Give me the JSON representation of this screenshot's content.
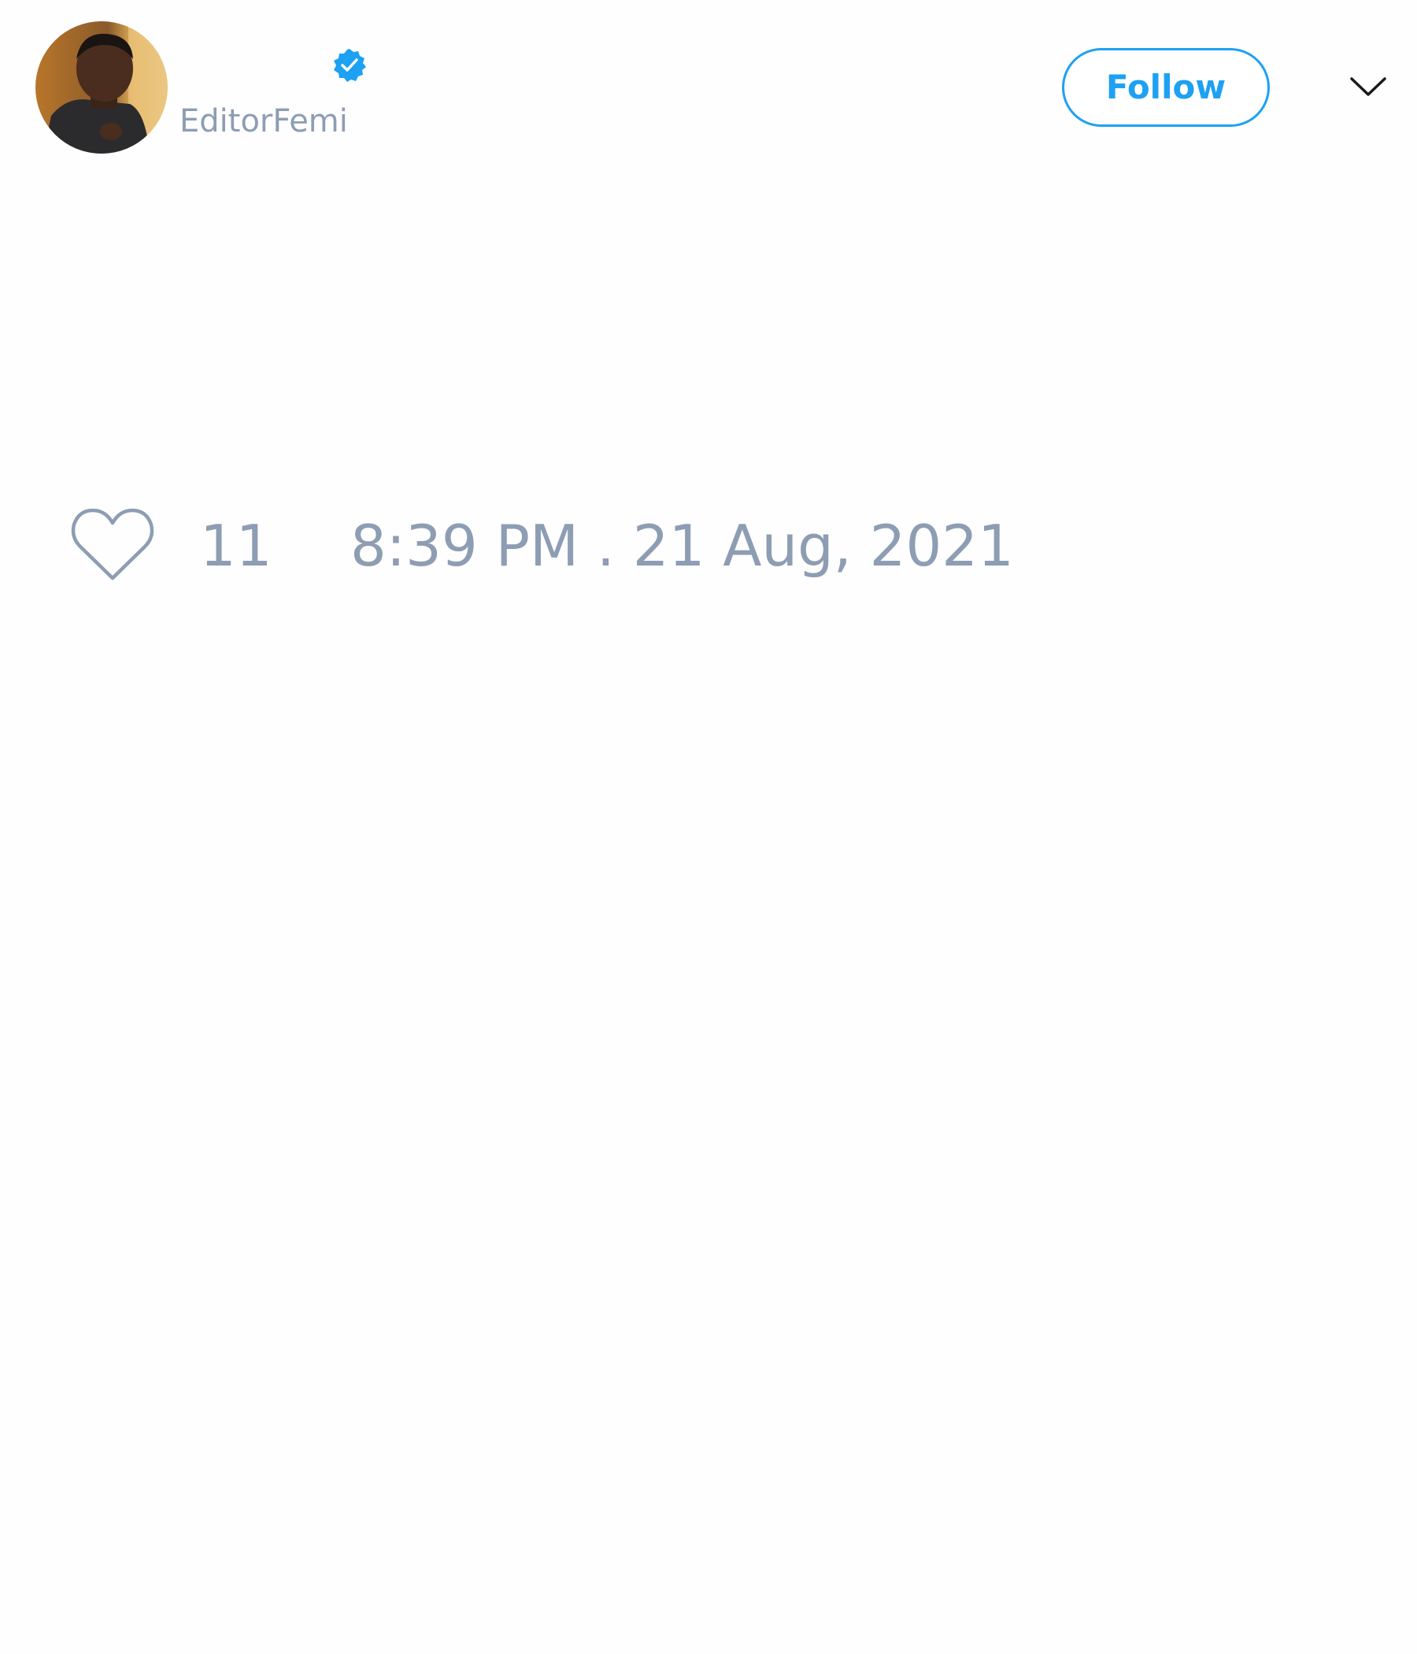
{
  "tweet": {
    "author": {
      "handle": "EditorFemi",
      "avatar_icon": "profile-photo",
      "verified": true,
      "verified_icon": "verified-badge-icon"
    },
    "follow_label": "Follow",
    "more_icon": "chevron-down-icon",
    "like_icon": "heart-outline-icon",
    "like_count": "11",
    "timestamp": "8:39 PM . 21 Aug, 2021"
  },
  "colors": {
    "accent": "#1da1f2",
    "muted_text": "#8d9db3",
    "background": "#fefefe"
  }
}
